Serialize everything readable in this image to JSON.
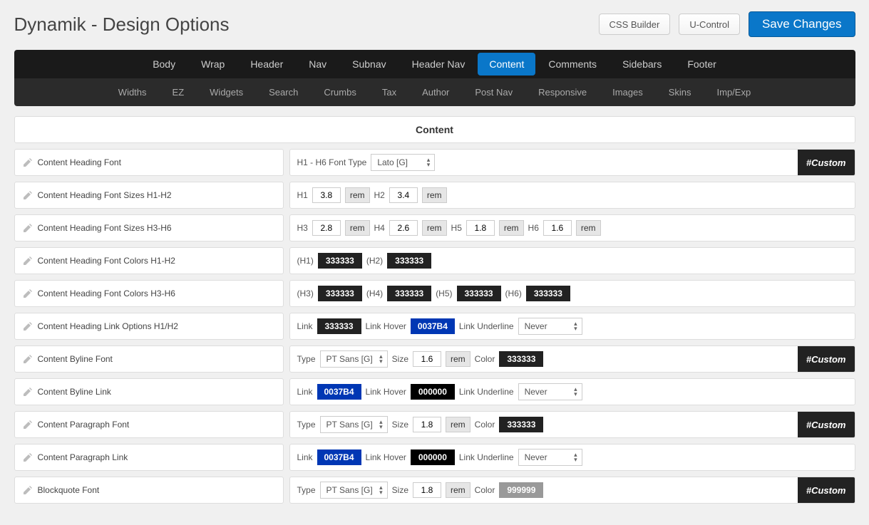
{
  "header": {
    "title": "Dynamik - Design Options",
    "buttons": {
      "css_builder": "CSS Builder",
      "u_control": "U-Control",
      "save": "Save Changes"
    }
  },
  "nav1": [
    "Body",
    "Wrap",
    "Header",
    "Nav",
    "Subnav",
    "Header Nav",
    "Content",
    "Comments",
    "Sidebars",
    "Footer"
  ],
  "nav1_active": "Content",
  "nav2": [
    "Widths",
    "EZ",
    "Widgets",
    "Search",
    "Crumbs",
    "Tax",
    "Author",
    "Post Nav",
    "Responsive",
    "Images",
    "Skins",
    "Imp/Exp"
  ],
  "section": {
    "title": "Content"
  },
  "custom_label": "#Custom",
  "rows": {
    "r0": {
      "label": "Content Heading Font",
      "font_type_label": "H1 - H6 Font Type",
      "font_type_value": "Lato [G]",
      "custom": true
    },
    "r1": {
      "label": "Content Heading Font Sizes H1-H2",
      "h1_label": "H1",
      "h1_val": "3.8",
      "h1_unit": "rem",
      "h2_label": "H2",
      "h2_val": "3.4",
      "h2_unit": "rem"
    },
    "r2": {
      "label": "Content Heading Font Sizes H3-H6",
      "h3_label": "H3",
      "h3_val": "2.8",
      "h3_unit": "rem",
      "h4_label": "H4",
      "h4_val": "2.6",
      "h4_unit": "rem",
      "h5_label": "H5",
      "h5_val": "1.8",
      "h5_unit": "rem",
      "h6_label": "H6",
      "h6_val": "1.6",
      "h6_unit": "rem"
    },
    "r3": {
      "label": "Content Heading Font Colors H1-H2",
      "h1_label": "(H1)",
      "h1_val": "333333",
      "h2_label": "(H2)",
      "h2_val": "333333"
    },
    "r4": {
      "label": "Content Heading Font Colors H3-H6",
      "h3_label": "(H3)",
      "h3_val": "333333",
      "h4_label": "(H4)",
      "h4_val": "333333",
      "h5_label": "(H5)",
      "h5_val": "333333",
      "h6_label": "(H6)",
      "h6_val": "333333"
    },
    "r5": {
      "label": "Content Heading Link Options H1/H2",
      "link_label": "Link",
      "link_val": "333333",
      "hover_label": "Link Hover",
      "hover_val": "0037B4",
      "underline_label": "Link Underline",
      "underline_val": "Never"
    },
    "r6": {
      "label": "Content Byline Font",
      "type_label": "Type",
      "type_val": "PT Sans [G]",
      "size_label": "Size",
      "size_val": "1.6",
      "size_unit": "rem",
      "color_label": "Color",
      "color_val": "333333",
      "custom": true
    },
    "r7": {
      "label": "Content Byline Link",
      "link_label": "Link",
      "link_val": "0037B4",
      "hover_label": "Link Hover",
      "hover_val": "000000",
      "underline_label": "Link Underline",
      "underline_val": "Never"
    },
    "r8": {
      "label": "Content Paragraph Font",
      "type_label": "Type",
      "type_val": "PT Sans [G]",
      "size_label": "Size",
      "size_val": "1.8",
      "size_unit": "rem",
      "color_label": "Color",
      "color_val": "333333",
      "custom": true
    },
    "r9": {
      "label": "Content Paragraph Link",
      "link_label": "Link",
      "link_val": "0037B4",
      "hover_label": "Link Hover",
      "hover_val": "000000",
      "underline_label": "Link Underline",
      "underline_val": "Never"
    },
    "r10": {
      "label": "Blockquote Font",
      "type_label": "Type",
      "type_val": "PT Sans [G]",
      "size_label": "Size",
      "size_val": "1.8",
      "size_unit": "rem",
      "color_label": "Color",
      "color_val": "999999",
      "custom": true
    }
  }
}
